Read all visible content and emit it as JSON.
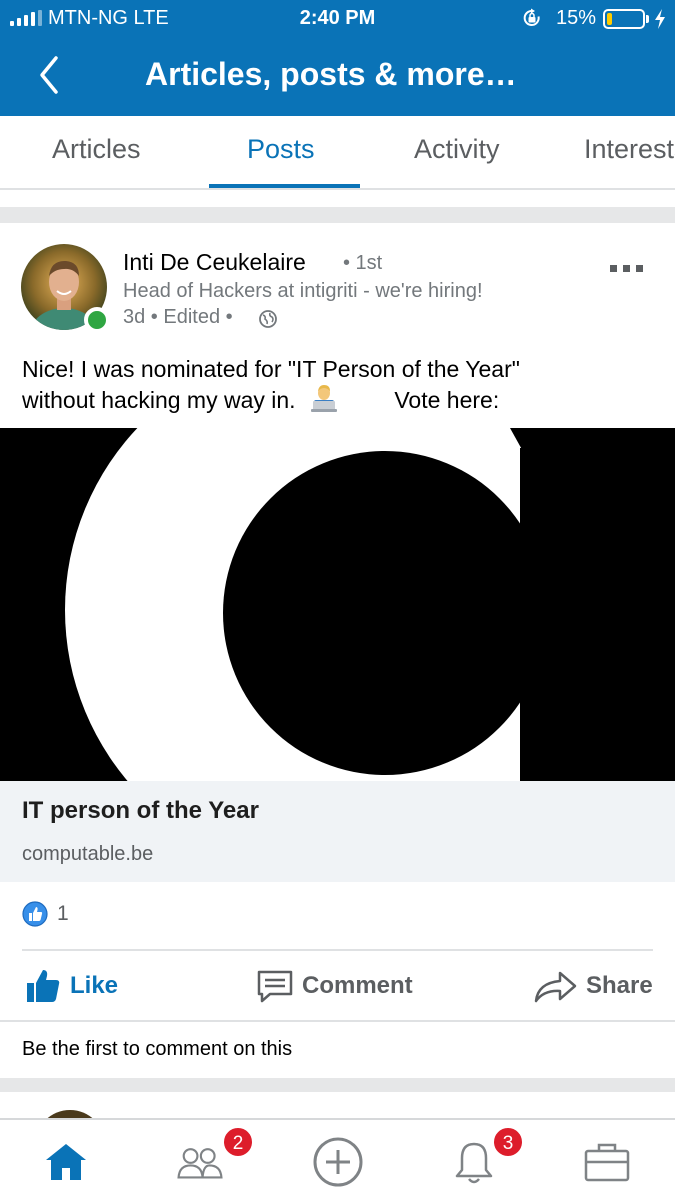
{
  "status_bar": {
    "carrier": "MTN-NG   LTE",
    "time": "2:40 PM",
    "battery_percent": "15%",
    "battery_level": 0.15,
    "icons": [
      "signal-bars-icon",
      "rotation-lock-icon",
      "battery-icon",
      "charging-bolt-icon"
    ]
  },
  "header": {
    "title": "Articles, posts & more…",
    "back_icon": "chevron-left-icon"
  },
  "tabs": [
    {
      "label": "Articles",
      "active": false
    },
    {
      "label": "Posts",
      "active": true
    },
    {
      "label": "Activity",
      "active": false
    },
    {
      "label": "Interests",
      "active": false
    }
  ],
  "post": {
    "author": {
      "name": "Inti De Ceukelaire",
      "degree": "• 1st",
      "headline": "Head of Hackers at intigriti - we're hiring!",
      "online": true
    },
    "meta": "3d • Edited •",
    "visibility_icon": "globe-icon",
    "more_icon": "more-options-icon",
    "text_line1": "Nice! I was nominated for \"IT Person of the Year\"",
    "text_line2": "without hacking my way in.",
    "emoji": "technologist-emoji",
    "text_line2_suffix": "Vote here:",
    "article": {
      "title": "IT person of the Year",
      "source": "computable.be"
    },
    "reaction_count": "1",
    "actions": {
      "like": "Like",
      "comment": "Comment",
      "share": "Share"
    },
    "first_comment_prompt": "Be the first to comment on this"
  },
  "bottom_nav": {
    "items": [
      {
        "icon": "home-icon",
        "active": true,
        "badge": ""
      },
      {
        "icon": "my-network-icon",
        "active": false,
        "badge": "2"
      },
      {
        "icon": "post-plus-icon",
        "active": false,
        "badge": ""
      },
      {
        "icon": "notifications-bell-icon",
        "active": false,
        "badge": "3"
      },
      {
        "icon": "jobs-briefcase-icon",
        "active": false,
        "badge": ""
      }
    ]
  },
  "colors": {
    "brand_blue": "#0a73b7",
    "online_green": "#2fa642",
    "badge_red": "#dd1d2b",
    "text_gray": "#5b5e61"
  }
}
